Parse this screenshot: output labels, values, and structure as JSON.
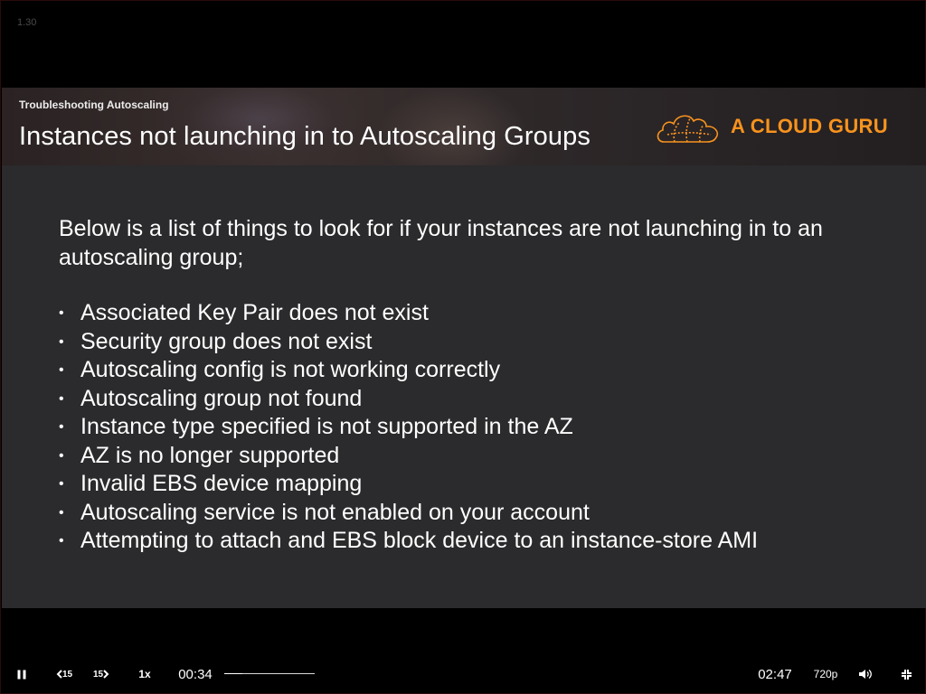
{
  "overlay": {
    "version_label": "1.30"
  },
  "slide": {
    "kicker": "Troubleshooting Autoscaling",
    "title": "Instances not launching in to Autoscaling Groups",
    "brand_name": "A CLOUD GURU",
    "brand_color": "#f7931e",
    "intro": "Below is a list of things to look for if your instances are not launching in to an autoscaling group;",
    "bullets": [
      "Associated Key Pair does not exist",
      "Security group does not exist",
      "Autoscaling config is not working correctly",
      "Autoscaling group not found",
      "Instance type specified is not supported in the AZ",
      "AZ is no longer supported",
      "Invalid EBS device mapping",
      "Autoscaling service is not enabled on your account",
      "Attempting to attach and EBS block device to an instance-store AMI"
    ]
  },
  "player": {
    "pause_icon": "pause-icon",
    "skip_back_label": "15",
    "skip_forward_label": "15",
    "speed_label": "1x",
    "current_time": "00:34",
    "total_time": "02:47",
    "progress_fraction": 0.2036,
    "quality_label": "720p",
    "volume_icon": "volume-icon",
    "exit_fullscreen_icon": "exit-fullscreen-icon"
  }
}
